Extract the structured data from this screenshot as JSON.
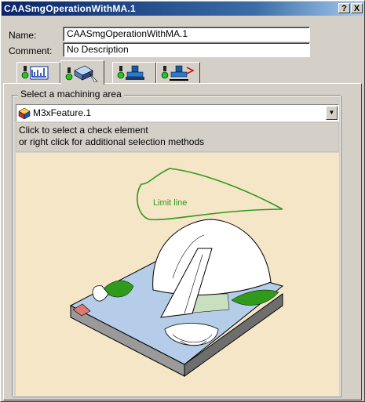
{
  "window": {
    "title": "CAASmgOperationWithMA.1",
    "help_button": "?",
    "close_button": "X"
  },
  "form": {
    "name_label": "Name:",
    "name_value": "CAASmgOperationWithMA.1",
    "comment_label": "Comment:",
    "comment_value": "No Description"
  },
  "tabs": [
    {
      "icon": "strategy-parameters-icon",
      "active": false
    },
    {
      "icon": "geometry-icon",
      "active": true
    },
    {
      "icon": "tool-icon",
      "active": false
    },
    {
      "icon": "feeds-speeds-icon",
      "active": false
    }
  ],
  "machining_area": {
    "group_label": "Select a machining area",
    "selected": "M3xFeature.1",
    "hint_line1": "Click to select a check element",
    "hint_line2": "or right click for additional selection methods",
    "limit_line_label": "Limit line"
  },
  "colors": {
    "title_start": "#0a246a",
    "title_end": "#a6caf0",
    "illustration_bg": "#f5e6c8",
    "limit_line": "#2f9a1c"
  }
}
